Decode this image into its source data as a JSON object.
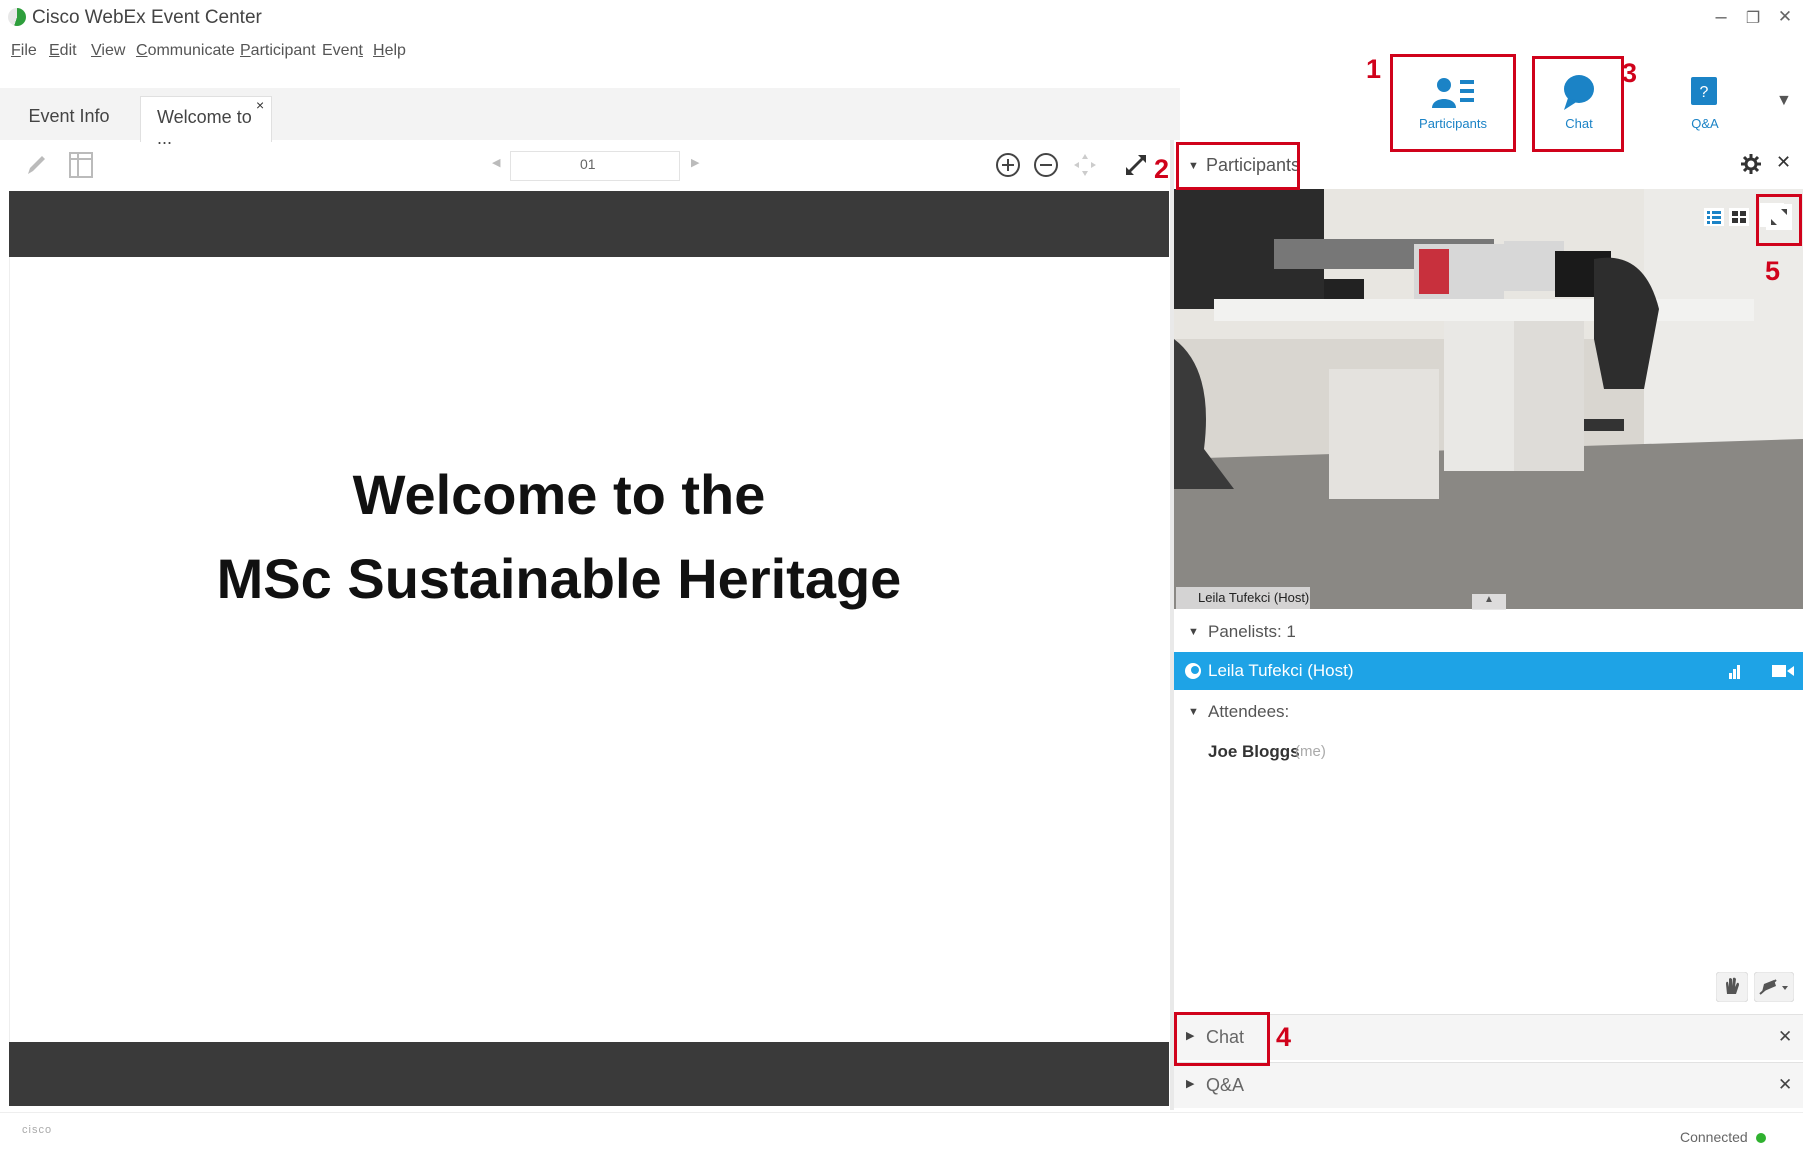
{
  "window": {
    "title": "Cisco WebEx Event Center",
    "minimize": "–",
    "restore": "❐",
    "close": "✕"
  },
  "menu": [
    {
      "first": "F",
      "rest": "ile"
    },
    {
      "first": "E",
      "rest": "dit"
    },
    {
      "first": "V",
      "rest": "iew"
    },
    {
      "first": "C",
      "rest": "ommunicate"
    },
    {
      "first": "P",
      "rest": "articipant"
    },
    {
      "first": "Even",
      "rest": "t"
    },
    {
      "first": "H",
      "rest": "elp"
    }
  ],
  "tabs": {
    "event_info": "Event Info",
    "welcome": "Welcome to ...",
    "close": "×"
  },
  "toolbar_buttons": {
    "participants": "Participants",
    "chat": "Chat",
    "qa": "Q&A",
    "more": "▼"
  },
  "annotations": [
    "1",
    "2",
    "3",
    "4",
    "5"
  ],
  "presentation": {
    "page": "01",
    "prev": "◀",
    "next": "▶",
    "line1": "Welcome to the",
    "line2": "MSc Sustainable Heritage"
  },
  "participants_panel": {
    "title": "Participants",
    "video_name": "Leila Tufekci (Host)",
    "panelists_label": "Panelists: 1",
    "host": "Leila Tufekci (Host)",
    "attendees_label": "Attendees:",
    "attendee_name": "Joe Bloggs",
    "attendee_suffix": "(me)"
  },
  "sections": {
    "chat": "Chat",
    "qa": "Q&A",
    "close": "✕"
  },
  "status": {
    "text": "Connected",
    "logo": "cisco"
  },
  "colors": {
    "accent_blue": "#1ea3e6",
    "annotation_red": "#d0021b",
    "slide_band": "#3a3a3a",
    "status_green": "#2fb12f"
  }
}
